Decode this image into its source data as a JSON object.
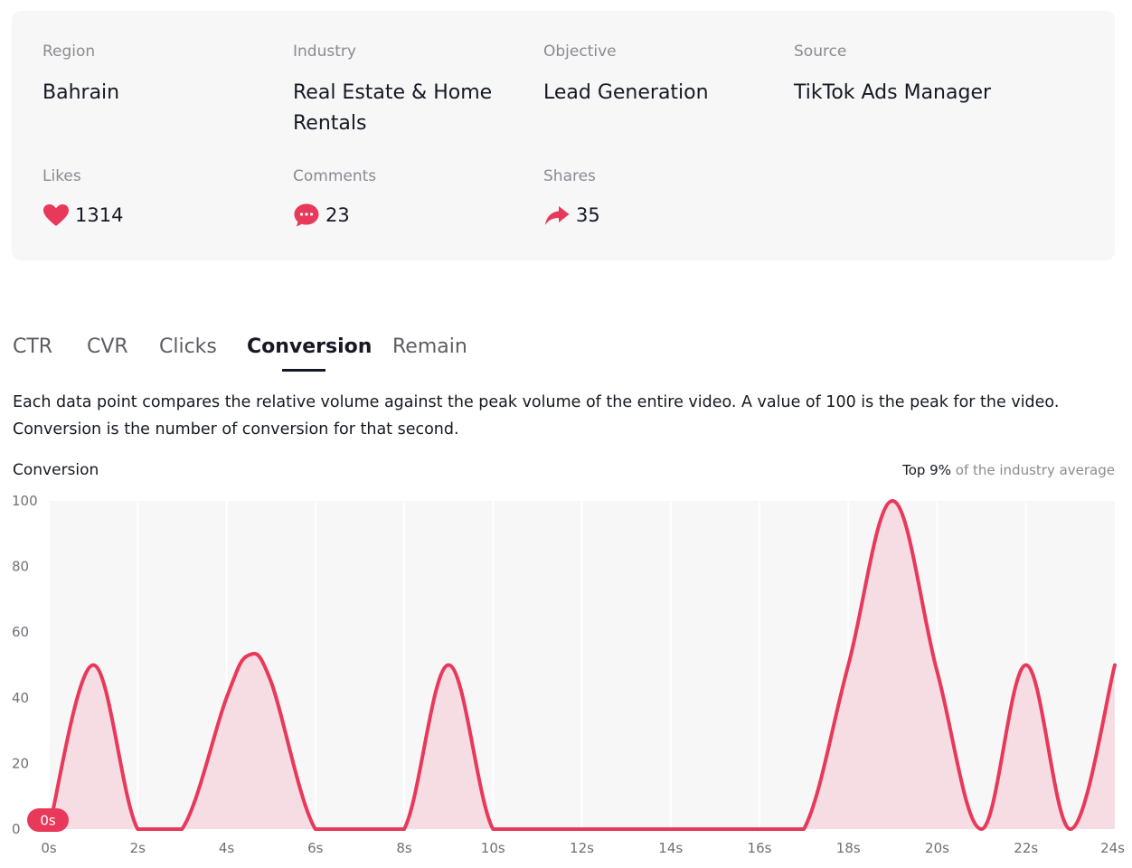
{
  "details": {
    "region": {
      "label": "Region",
      "value": "Bahrain"
    },
    "industry": {
      "label": "Industry",
      "value_line1": "Real Estate & Home",
      "value_line2": "Rentals"
    },
    "objective": {
      "label": "Objective",
      "value": "Lead Generation"
    },
    "source": {
      "label": "Source",
      "value": "TikTok Ads Manager"
    }
  },
  "stats": {
    "likes": {
      "label": "Likes",
      "value": "1314",
      "icon": "heart-icon"
    },
    "comments": {
      "label": "Comments",
      "value": "23",
      "icon": "comment-bubble-icon"
    },
    "shares": {
      "label": "Shares",
      "value": "35",
      "icon": "share-arrow-icon"
    }
  },
  "tabs": [
    {
      "label": "CTR",
      "active": false
    },
    {
      "label": "CVR",
      "active": false
    },
    {
      "label": "Clicks",
      "active": false
    },
    {
      "label": "Conversion",
      "active": true
    },
    {
      "label": "Remain",
      "active": false
    }
  ],
  "description": {
    "line1": "Each data point compares the relative volume against the peak volume of the entire video. A value of 100 is the peak for the video.",
    "line2": "Conversion is the number of conversion for that second."
  },
  "chart": {
    "title": "Conversion",
    "rank_strong": "Top 9%",
    "rank_muted": "of the industry average",
    "marker_label": "0s"
  },
  "colors": {
    "accent": "#e8395a",
    "area_fill": "#f5dde3",
    "plot_bg": "#f7f7f7",
    "card_bg": "#f7f7f7"
  },
  "chart_data": {
    "type": "line",
    "title": "Conversion",
    "xlabel": "",
    "ylabel": "",
    "x": [
      0,
      1,
      2,
      3,
      4,
      4.5,
      5,
      6,
      7,
      8,
      9,
      10,
      11,
      12,
      13,
      14,
      15,
      16,
      17,
      18,
      19,
      20,
      21,
      22,
      23,
      24
    ],
    "values": [
      0,
      50,
      0,
      0,
      40,
      53,
      45,
      0,
      0,
      0,
      50,
      0,
      0,
      0,
      0,
      0,
      0,
      0,
      0,
      50,
      100,
      48,
      0,
      50,
      0,
      50
    ],
    "x_ticks": [
      "0s",
      "2s",
      "4s",
      "6s",
      "8s",
      "10s",
      "12s",
      "14s",
      "16s",
      "18s",
      "20s",
      "22s",
      "24s"
    ],
    "y_ticks": [
      "0",
      "20",
      "40",
      "60",
      "80",
      "100"
    ],
    "xlim": [
      0,
      24
    ],
    "ylim": [
      0,
      100
    ],
    "grid": "vertical lines",
    "legend": "none"
  }
}
